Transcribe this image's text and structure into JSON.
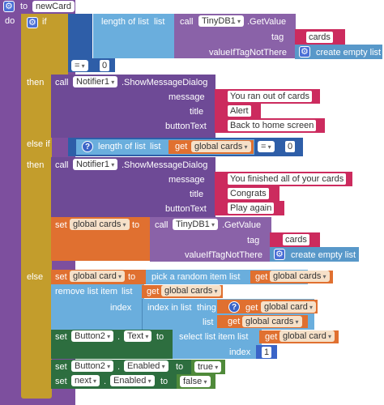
{
  "proc": {
    "to": "to",
    "name": "newCard",
    "do": "do"
  },
  "if1": {
    "if": "if",
    "length_label": "length of list",
    "list_label": "list",
    "call": "call",
    "db": "TinyDB1",
    "getvalue": ".GetValue",
    "tag_label": "tag",
    "tag_value": "cards",
    "vin_label": "valueIfTagNotThere",
    "create_empty": "create empty list",
    "op": "=",
    "num": "0"
  },
  "then1": {
    "then": "then",
    "call": "call",
    "notifier": "Notifier1",
    "method": ".ShowMessageDialog",
    "message_label": "message",
    "message": "You ran out of cards",
    "title_label": "title",
    "title": "Alert",
    "button_label": "buttonText",
    "button": "Back to home screen"
  },
  "elseif": {
    "elseif": "else if",
    "length_label": "length of list",
    "list_label": "list",
    "get": "get",
    "var": "global cards",
    "op": "=",
    "num": "0"
  },
  "then2": {
    "then": "then",
    "call": "call",
    "notifier": "Notifier1",
    "method": ".ShowMessageDialog",
    "message_label": "message",
    "message": "You finished all of your cards",
    "title_label": "title",
    "title": "Congrats",
    "button_label": "buttonText",
    "button": "Play again",
    "set": "set",
    "set_var": "global cards",
    "to": "to",
    "call2": "call",
    "db": "TinyDB1",
    "getvalue": ".GetValue",
    "tag_label": "tag",
    "tag_value": "cards",
    "vin_label": "valueIfTagNotThere",
    "create_empty": "create empty list"
  },
  "else": {
    "else": "else",
    "set": "set",
    "set_var": "global card",
    "to": "to",
    "pick": "pick a random item",
    "list_label": "list",
    "get": "get",
    "var_cards": "global cards",
    "remove": "remove list item",
    "remove_list": "list",
    "index_label": "index",
    "index_in_list": "index in list",
    "thing_label": "thing",
    "var_card": "global card",
    "set_btn": "set",
    "button2": "Button2",
    "text_prop": "Text",
    "select": "select list item",
    "select_list": "list",
    "index2_label": "index",
    "num1": "1",
    "enabled_prop": "Enabled",
    "true_val": "true",
    "next": "next",
    "false_val": "false",
    "dot": "."
  }
}
